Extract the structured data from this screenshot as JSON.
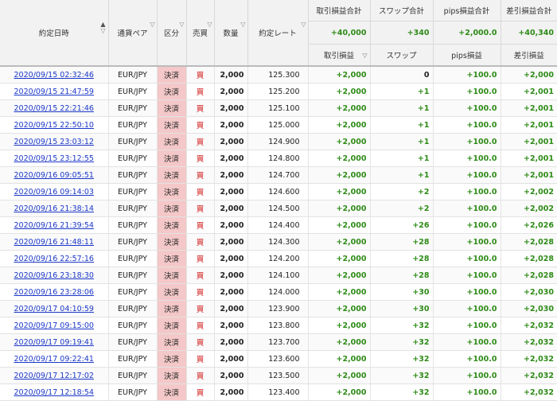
{
  "headers": {
    "time": "約定日時",
    "pair": "通貨ペア",
    "kind": "区分",
    "side": "売買",
    "qty": "数量",
    "rate": "約定レート",
    "pnl_total_label": "取引損益合計",
    "swap_total_label": "スワップ合計",
    "pips_total_label": "pips損益合計",
    "net_total_label": "差引損益合計",
    "pnl_total": "+40,000",
    "swap_total": "+340",
    "pips_total": "+2,000.0",
    "net_total": "+40,340",
    "pnl": "取引損益",
    "swap": "スワップ",
    "pips": "pips損益",
    "net": "差引損益"
  },
  "sort_icons": {
    "up": "▲",
    "down": "▽"
  },
  "colors": {
    "positive": "#2e8b17",
    "link": "#1b37c7",
    "kind_bg": "#f4c8c8",
    "buy": "#d01818"
  },
  "rows": [
    {
      "time": "2020/09/15 02:32:46",
      "pair": "EUR/JPY",
      "kind": "決済",
      "side": "買",
      "qty": "2,000",
      "rate": "125.300",
      "pnl": "+2,000",
      "swap": "0",
      "pips": "+100.0",
      "net": "+2,000"
    },
    {
      "time": "2020/09/15 21:47:59",
      "pair": "EUR/JPY",
      "kind": "決済",
      "side": "買",
      "qty": "2,000",
      "rate": "125.200",
      "pnl": "+2,000",
      "swap": "+1",
      "pips": "+100.0",
      "net": "+2,001"
    },
    {
      "time": "2020/09/15 22:21:46",
      "pair": "EUR/JPY",
      "kind": "決済",
      "side": "買",
      "qty": "2,000",
      "rate": "125.100",
      "pnl": "+2,000",
      "swap": "+1",
      "pips": "+100.0",
      "net": "+2,001"
    },
    {
      "time": "2020/09/15 22:50:10",
      "pair": "EUR/JPY",
      "kind": "決済",
      "side": "買",
      "qty": "2,000",
      "rate": "125.000",
      "pnl": "+2,000",
      "swap": "+1",
      "pips": "+100.0",
      "net": "+2,001"
    },
    {
      "time": "2020/09/15 23:03:12",
      "pair": "EUR/JPY",
      "kind": "決済",
      "side": "買",
      "qty": "2,000",
      "rate": "124.900",
      "pnl": "+2,000",
      "swap": "+1",
      "pips": "+100.0",
      "net": "+2,001"
    },
    {
      "time": "2020/09/15 23:12:55",
      "pair": "EUR/JPY",
      "kind": "決済",
      "side": "買",
      "qty": "2,000",
      "rate": "124.800",
      "pnl": "+2,000",
      "swap": "+1",
      "pips": "+100.0",
      "net": "+2,001"
    },
    {
      "time": "2020/09/16 09:05:51",
      "pair": "EUR/JPY",
      "kind": "決済",
      "side": "買",
      "qty": "2,000",
      "rate": "124.700",
      "pnl": "+2,000",
      "swap": "+1",
      "pips": "+100.0",
      "net": "+2,001"
    },
    {
      "time": "2020/09/16 09:14:03",
      "pair": "EUR/JPY",
      "kind": "決済",
      "side": "買",
      "qty": "2,000",
      "rate": "124.600",
      "pnl": "+2,000",
      "swap": "+2",
      "pips": "+100.0",
      "net": "+2,002"
    },
    {
      "time": "2020/09/16 21:38:14",
      "pair": "EUR/JPY",
      "kind": "決済",
      "side": "買",
      "qty": "2,000",
      "rate": "124.500",
      "pnl": "+2,000",
      "swap": "+2",
      "pips": "+100.0",
      "net": "+2,002"
    },
    {
      "time": "2020/09/16 21:39:54",
      "pair": "EUR/JPY",
      "kind": "決済",
      "side": "買",
      "qty": "2,000",
      "rate": "124.400",
      "pnl": "+2,000",
      "swap": "+26",
      "pips": "+100.0",
      "net": "+2,026"
    },
    {
      "time": "2020/09/16 21:48:11",
      "pair": "EUR/JPY",
      "kind": "決済",
      "side": "買",
      "qty": "2,000",
      "rate": "124.300",
      "pnl": "+2,000",
      "swap": "+28",
      "pips": "+100.0",
      "net": "+2,028"
    },
    {
      "time": "2020/09/16 22:57:16",
      "pair": "EUR/JPY",
      "kind": "決済",
      "side": "買",
      "qty": "2,000",
      "rate": "124.200",
      "pnl": "+2,000",
      "swap": "+28",
      "pips": "+100.0",
      "net": "+2,028"
    },
    {
      "time": "2020/09/16 23:18:30",
      "pair": "EUR/JPY",
      "kind": "決済",
      "side": "買",
      "qty": "2,000",
      "rate": "124.100",
      "pnl": "+2,000",
      "swap": "+28",
      "pips": "+100.0",
      "net": "+2,028"
    },
    {
      "time": "2020/09/16 23:28:06",
      "pair": "EUR/JPY",
      "kind": "決済",
      "side": "買",
      "qty": "2,000",
      "rate": "124.000",
      "pnl": "+2,000",
      "swap": "+30",
      "pips": "+100.0",
      "net": "+2,030"
    },
    {
      "time": "2020/09/17 04:10:59",
      "pair": "EUR/JPY",
      "kind": "決済",
      "side": "買",
      "qty": "2,000",
      "rate": "123.900",
      "pnl": "+2,000",
      "swap": "+30",
      "pips": "+100.0",
      "net": "+2,030"
    },
    {
      "time": "2020/09/17 09:15:00",
      "pair": "EUR/JPY",
      "kind": "決済",
      "side": "買",
      "qty": "2,000",
      "rate": "123.800",
      "pnl": "+2,000",
      "swap": "+32",
      "pips": "+100.0",
      "net": "+2,032"
    },
    {
      "time": "2020/09/17 09:19:41",
      "pair": "EUR/JPY",
      "kind": "決済",
      "side": "買",
      "qty": "2,000",
      "rate": "123.700",
      "pnl": "+2,000",
      "swap": "+32",
      "pips": "+100.0",
      "net": "+2,032"
    },
    {
      "time": "2020/09/17 09:22:41",
      "pair": "EUR/JPY",
      "kind": "決済",
      "side": "買",
      "qty": "2,000",
      "rate": "123.600",
      "pnl": "+2,000",
      "swap": "+32",
      "pips": "+100.0",
      "net": "+2,032"
    },
    {
      "time": "2020/09/17 12:17:02",
      "pair": "EUR/JPY",
      "kind": "決済",
      "side": "買",
      "qty": "2,000",
      "rate": "123.500",
      "pnl": "+2,000",
      "swap": "+32",
      "pips": "+100.0",
      "net": "+2,032"
    },
    {
      "time": "2020/09/17 12:18:54",
      "pair": "EUR/JPY",
      "kind": "決済",
      "side": "買",
      "qty": "2,000",
      "rate": "123.400",
      "pnl": "+2,000",
      "swap": "+32",
      "pips": "+100.0",
      "net": "+2,032"
    }
  ]
}
